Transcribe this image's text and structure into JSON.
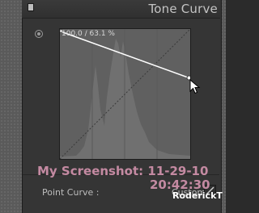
{
  "panel": {
    "title": "Tone Curve"
  },
  "curve": {
    "readout": "100.0 / 63.1 %"
  },
  "point_curve": {
    "label": "Point Curve :",
    "value": "Custom"
  },
  "watermark": {
    "line1": "My Screenshot: 11-29-10",
    "line2": "20:42:30",
    "author": "RoderickT"
  },
  "colors": {
    "curve_background": "#606060",
    "histogram": "#707070",
    "watermark": "#c48aa2"
  },
  "icons": {
    "panel_toggle": "square-toggle-icon",
    "target_adjust": "target-adjust-icon",
    "edit": "edit-pencil-icon",
    "cursor": "arrow-cursor-icon"
  }
}
